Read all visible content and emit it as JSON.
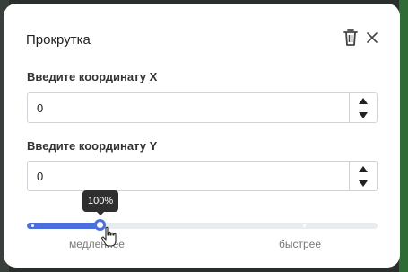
{
  "dialog": {
    "title": "Прокрутка",
    "icons": {
      "delete": "trash-icon",
      "close": "close-icon"
    }
  },
  "x_field": {
    "label": "Введите координату X",
    "value": "0"
  },
  "y_field": {
    "label": "Введите координату Y",
    "value": "0"
  },
  "speed": {
    "value_percent": 100,
    "tooltip": "100%",
    "min_label": "медленнее",
    "max_label": "быстрее",
    "fill_fraction": 0.21
  },
  "colors": {
    "accent": "#4c6fde",
    "track": "#e9ecef",
    "tooltip_bg": "#2f2f2f"
  }
}
